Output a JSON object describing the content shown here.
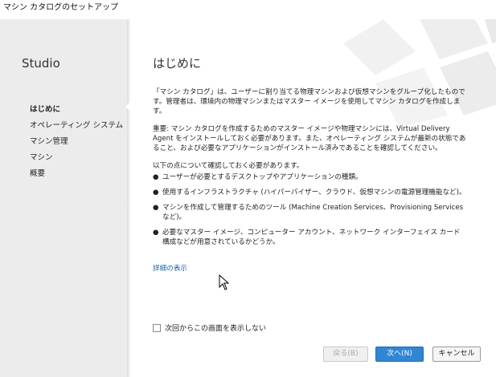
{
  "window": {
    "title": "マシン カタログのセットアップ"
  },
  "sidebar": {
    "brand": "Studio",
    "items": [
      {
        "label": "はじめに",
        "active": true
      },
      {
        "label": "オペレーティング システム",
        "active": false
      },
      {
        "label": "マシン管理",
        "active": false
      },
      {
        "label": "マシン",
        "active": false
      },
      {
        "label": "概要",
        "active": false
      }
    ]
  },
  "main": {
    "title": "はじめに",
    "paragraphs": [
      "「マシン カタログ」は、ユーザーに割り当てる物理マシンおよび仮想マシンをグループ化したものです。管理者は、環境内の物理マシンまたはマスター イメージを使用してマシン カタログを作成します。",
      "重要: マシン カタログを作成するためのマスター イメージや物理マシンには、Virtual Delivery Agent をインストールしておく必要があります。また、オペレーティング システムが最新の状態であること、および必要なアプリケーションがインストール済みであることを確認してください。",
      "以下の点について確認しておく必要があります。"
    ],
    "checklist": [
      "ユーザーが必要とするデスクトップやアプリケーションの種類。",
      "使用するインフラストラクチャ (ハイパーバイザー、クラウド、仮想マシンの電源管理機能など)。",
      "マシンを作成して管理するためのツール (Machine Creation Services、Provisioning Services など)。",
      "必要なマスター イメージ、コンピューター アカウント、ネットワーク インターフェイス カード構成などが用意されているかどうか。"
    ],
    "bullet_glyph": "●",
    "more_link": "詳細の表示",
    "dont_show_again": "次回からこの画面を表示しない"
  },
  "buttons": {
    "back": "戻る(B)",
    "next": "次へ(N)",
    "cancel": "キャンセル"
  },
  "colors": {
    "sidebar_bg": "#ececec",
    "primary_button": "#2f86d6",
    "link": "#1a5fb4"
  }
}
